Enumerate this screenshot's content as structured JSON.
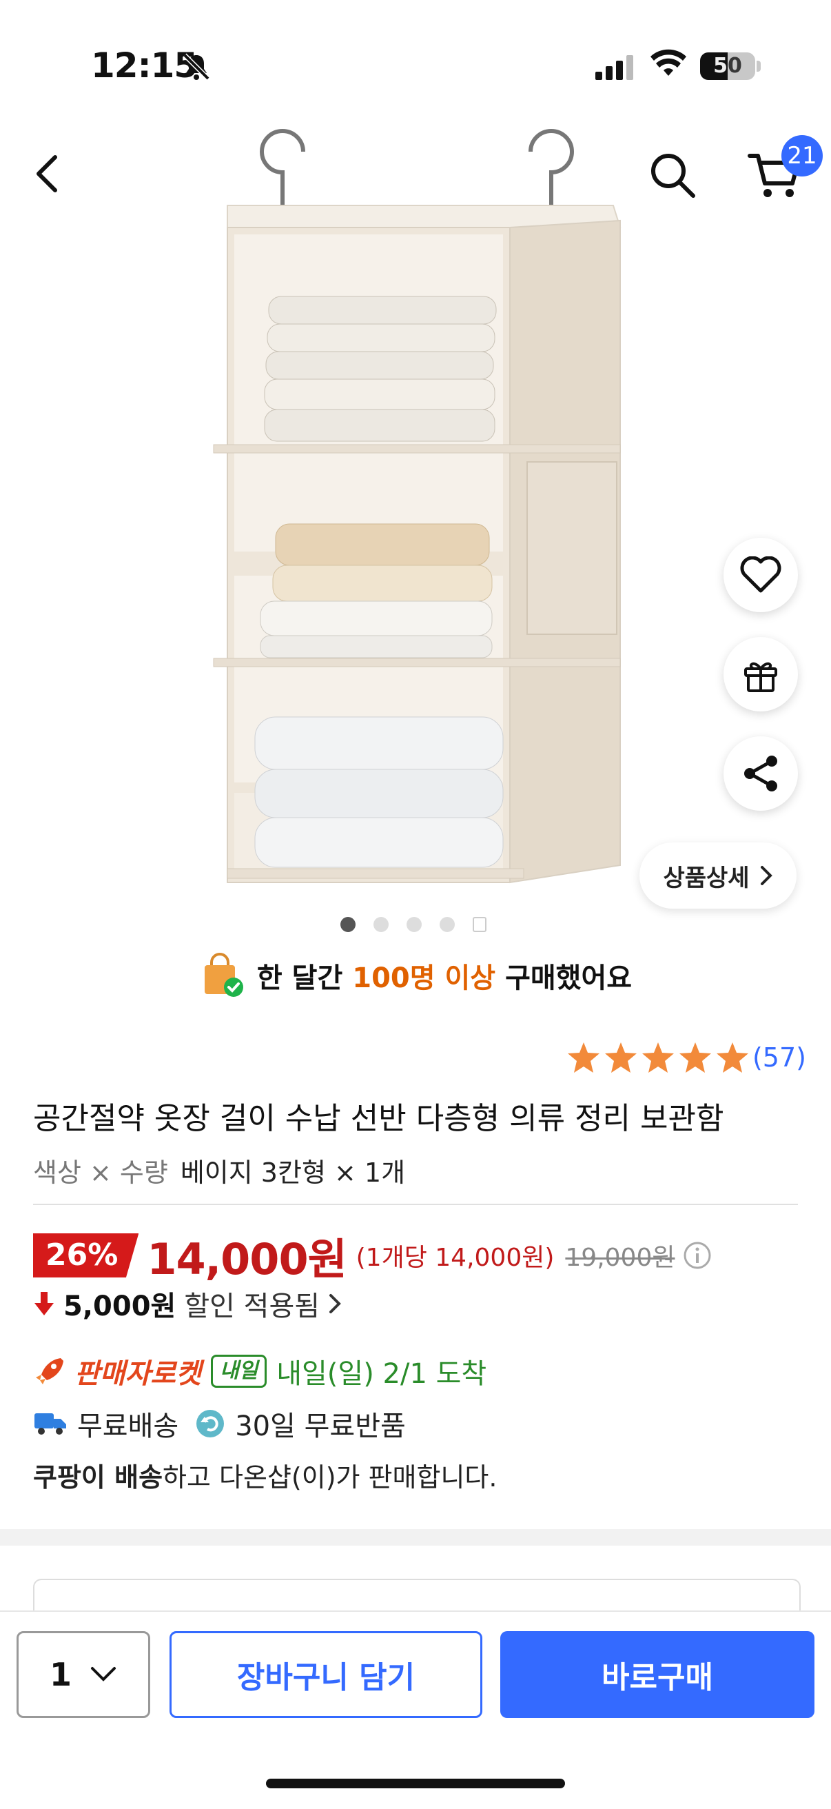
{
  "status_bar": {
    "time": "12:15",
    "battery": "50"
  },
  "nav": {
    "cart_count": "21"
  },
  "gallery": {
    "detail_label": "상품상세",
    "page_count": 5,
    "active_page": 1
  },
  "purchase_notice": {
    "prefix": "한 달간",
    "highlight": "100명 이상",
    "suffix": "구매했어요"
  },
  "rating": {
    "stars": 5,
    "count": "(57)"
  },
  "product": {
    "title": "공간절약 옷장 걸이 수납 선반 다층형 의류 정리 보관함",
    "option_label": "색상 × 수량",
    "option_value": "베이지 3칸형 × 1개"
  },
  "price": {
    "discount": "26%",
    "sale_price": "14,000원",
    "unit_price": "(1개당 14,000원)",
    "original_price": "19,000원"
  },
  "saving": {
    "amount": "5,000원",
    "text": "할인 적용됨"
  },
  "delivery": {
    "rocket_brand": "판매자로켓",
    "tag": "내일",
    "arrival": "내일(일) 2/1 도착",
    "free_shipping": "무료배송",
    "free_return": "30일 무료반품"
  },
  "seller": {
    "bold": "쿠팡이 배송",
    "rest": "하고 다온샵(이)가 판매합니다."
  },
  "bottom_bar": {
    "quantity": "1",
    "cart_label": "장바구니 담기",
    "buy_label": "바로구매"
  },
  "colors": {
    "accent": "#346aff",
    "price_red": "#c11a1a",
    "rocket_orange": "#e3461c",
    "arrival_green": "#2a8c2a",
    "highlight_orange": "#e06100"
  }
}
